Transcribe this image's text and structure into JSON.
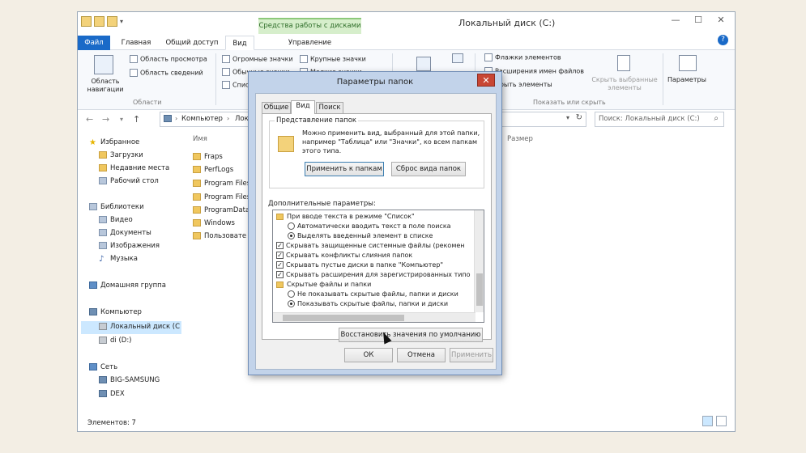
{
  "window": {
    "title": "Локальный диск (C:)",
    "context_tab": "Средства работы с дисками",
    "controls": {
      "minimize": "—",
      "maximize": "☐",
      "close": "✕"
    }
  },
  "tabs": [
    "Файл",
    "Главная",
    "Общий доступ",
    "Вид",
    "Управление"
  ],
  "ribbon": {
    "nav_pane": "Область навигации",
    "preview_pane": "Область просмотра",
    "details_pane": "Область сведений",
    "panes_group": "Области",
    "layout": [
      "Огромные значки",
      "Крупные значки",
      "Обычные значки",
      "Мелкие значки",
      "Спис"
    ],
    "checkboxes": [
      "Флажки элементов",
      "Расширения имен файлов",
      "крыть элементы"
    ],
    "hide_selected": "Скрыть выбранные элементы",
    "show_hide_group": "Показать или скрыть",
    "options": "Параметры"
  },
  "address": {
    "crumbs": [
      "Компьютер",
      "Локаль"
    ],
    "search_placeholder": "Поиск: Локальный диск (C:)"
  },
  "nav": {
    "favorites": "Избранное",
    "fav_items": [
      "Загрузки",
      "Недавние места",
      "Рабочий стол"
    ],
    "libraries": "Библиотеки",
    "lib_items": [
      "Видео",
      "Документы",
      "Изображения",
      "Музыка"
    ],
    "homegroup": "Домашняя группа",
    "computer": "Компьютер",
    "pc_items": [
      "Локальный диск (C",
      "di (D:)"
    ],
    "network": "Сеть",
    "net_items": [
      "BIG-SAMSUNG",
      "DEX"
    ]
  },
  "list": {
    "col_name": "Имя",
    "col_size": "Размер",
    "items": [
      "Fraps",
      "PerfLogs",
      "Program Files",
      "Program Files",
      "ProgramData",
      "Windows",
      "Пользовате"
    ]
  },
  "status": "Элементов: 7",
  "dialog": {
    "title": "Параметры папок",
    "tabs": [
      "Общие",
      "Вид",
      "Поиск"
    ],
    "folder_views_label": "Представление папок",
    "folder_views_desc": "Можно применить вид, выбранный для этой папки, например \"Таблица\" или \"Значки\", ко всем папкам этого типа.",
    "apply_to_folders": "Применить к папкам",
    "reset_folders": "Сброс вида папок",
    "advanced_label": "Дополнительные параметры:",
    "tree": [
      "При вводе текста в режиме \"Список\"",
      "Автоматически вводить текст в поле поиска",
      "Выделять введенный элемент в списке",
      "Скрывать защищенные системные файлы (рекомен",
      "Скрывать конфликты слияния папок",
      "Скрывать пустые диски в папке \"Компьютер\"",
      "Скрывать расширения для зарегистрированных типо",
      "Скрытые файлы и папки",
      "Не показывать скрытые файлы, папки и диски",
      "Показывать скрытые файлы, папки и диски"
    ],
    "restore_defaults": "Восстановить значения по умолчанию",
    "ok": "ОК",
    "cancel": "Отмена",
    "apply": "Применить"
  }
}
